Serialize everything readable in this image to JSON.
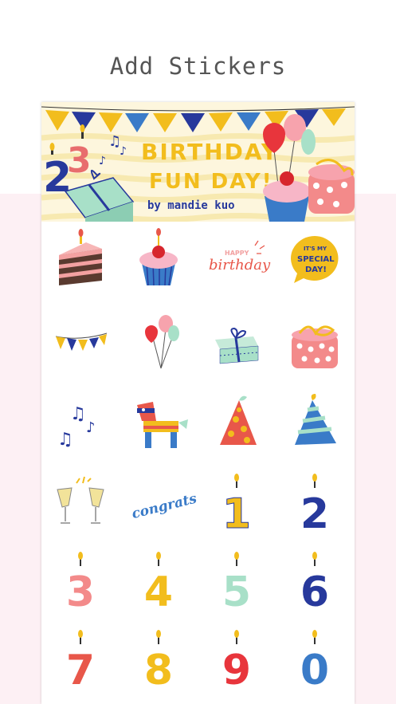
{
  "header": {
    "title": "Add Stickers"
  },
  "banner": {
    "title_line1": "BIRTHDAY",
    "title_line2": "FUN DAY!",
    "author": "by mandie kuo",
    "number_1": "2",
    "number_2": "3"
  },
  "stickers": [
    {
      "name": "cake-slice-sticker"
    },
    {
      "name": "cupcake-sticker"
    },
    {
      "name": "happy-birthday-script-sticker",
      "text_1": "HAPPY",
      "text_2": "birthday"
    },
    {
      "name": "special-day-bubble-sticker",
      "text_1": "IT'S MY",
      "text_2": "SPECIAL",
      "text_3": "DAY!"
    },
    {
      "name": "bunting-sticker"
    },
    {
      "name": "balloons-sticker"
    },
    {
      "name": "blue-gift-box-sticker"
    },
    {
      "name": "pink-gift-box-sticker"
    },
    {
      "name": "music-notes-sticker"
    },
    {
      "name": "pinata-sticker"
    },
    {
      "name": "party-hat-red-sticker"
    },
    {
      "name": "party-hat-blue-sticker"
    },
    {
      "name": "champagne-toast-sticker"
    },
    {
      "name": "congrats-sticker",
      "text_1": "congrats!"
    },
    {
      "name": "candle-1-sticker",
      "digit": "1"
    },
    {
      "name": "candle-2-sticker",
      "digit": "2"
    },
    {
      "name": "candle-3-sticker",
      "digit": "3"
    },
    {
      "name": "candle-4-sticker",
      "digit": "4"
    },
    {
      "name": "candle-5-sticker",
      "digit": "5"
    },
    {
      "name": "candle-6-sticker",
      "digit": "6"
    },
    {
      "name": "candle-7-sticker",
      "digit": "7"
    },
    {
      "name": "candle-8-sticker",
      "digit": "8"
    },
    {
      "name": "candle-9-sticker",
      "digit": "9"
    },
    {
      "name": "candle-0-sticker",
      "digit": "0"
    }
  ],
  "colors": {
    "yellow": "#f2bd1d",
    "blue": "#27399c",
    "red": "#e8574a",
    "pink": "#f7a3ad",
    "mint": "#a8e0c8",
    "page_pink": "#fdf0f4",
    "title_gray": "#555555"
  }
}
